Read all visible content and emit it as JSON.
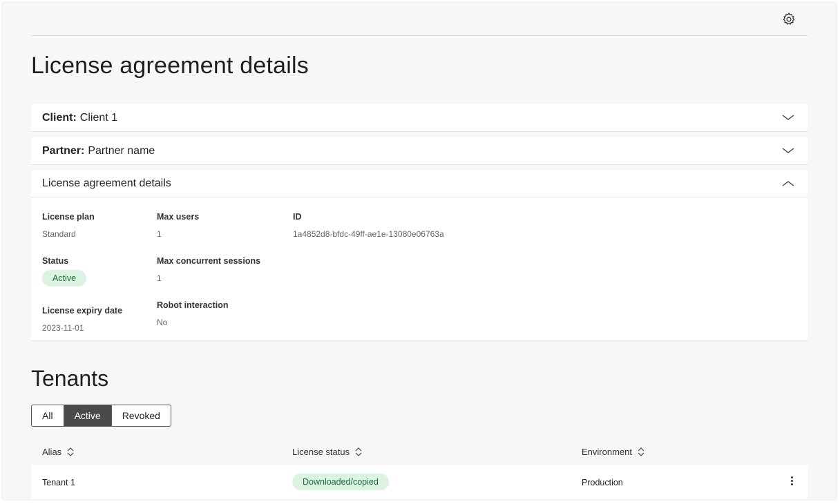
{
  "page": {
    "title": "License agreement details"
  },
  "accordions": {
    "client": {
      "label": "Client:",
      "value": "Client 1"
    },
    "partner": {
      "label": "Partner:",
      "value": "Partner name"
    },
    "details": {
      "label": "License agreement details"
    }
  },
  "details": {
    "license_plan": {
      "label": "License plan",
      "value": "Standard"
    },
    "status": {
      "label": "Status",
      "value": "Active"
    },
    "expiry": {
      "label": "License expiry date",
      "value": "2023-11-01"
    },
    "max_users": {
      "label": "Max users",
      "value": "1"
    },
    "max_sessions": {
      "label": "Max concurrent sessions",
      "value": "1"
    },
    "robot": {
      "label": "Robot interaction",
      "value": "No"
    },
    "id": {
      "label": "ID",
      "value": "1a4852d8-bfdc-49ff-ae1e-13080e06763a"
    }
  },
  "tenants": {
    "title": "Tenants",
    "filters": [
      "All",
      "Active",
      "Revoked"
    ],
    "selected_filter": "Active",
    "columns": [
      "Alias",
      "License status",
      "Environment"
    ],
    "rows": [
      {
        "alias": "Tenant 1",
        "license_status": "Downloaded/copied",
        "environment": "Production"
      }
    ]
  },
  "colors": {
    "background": "#f7f7f5",
    "badge_bg": "#dcf2e2",
    "badge_text": "#1d6b36",
    "segment_active": "#4a4a4a"
  },
  "icons": [
    "gear-icon",
    "chevron-down-icon",
    "chevron-up-icon",
    "sort-icon",
    "kebab-menu-icon"
  ]
}
